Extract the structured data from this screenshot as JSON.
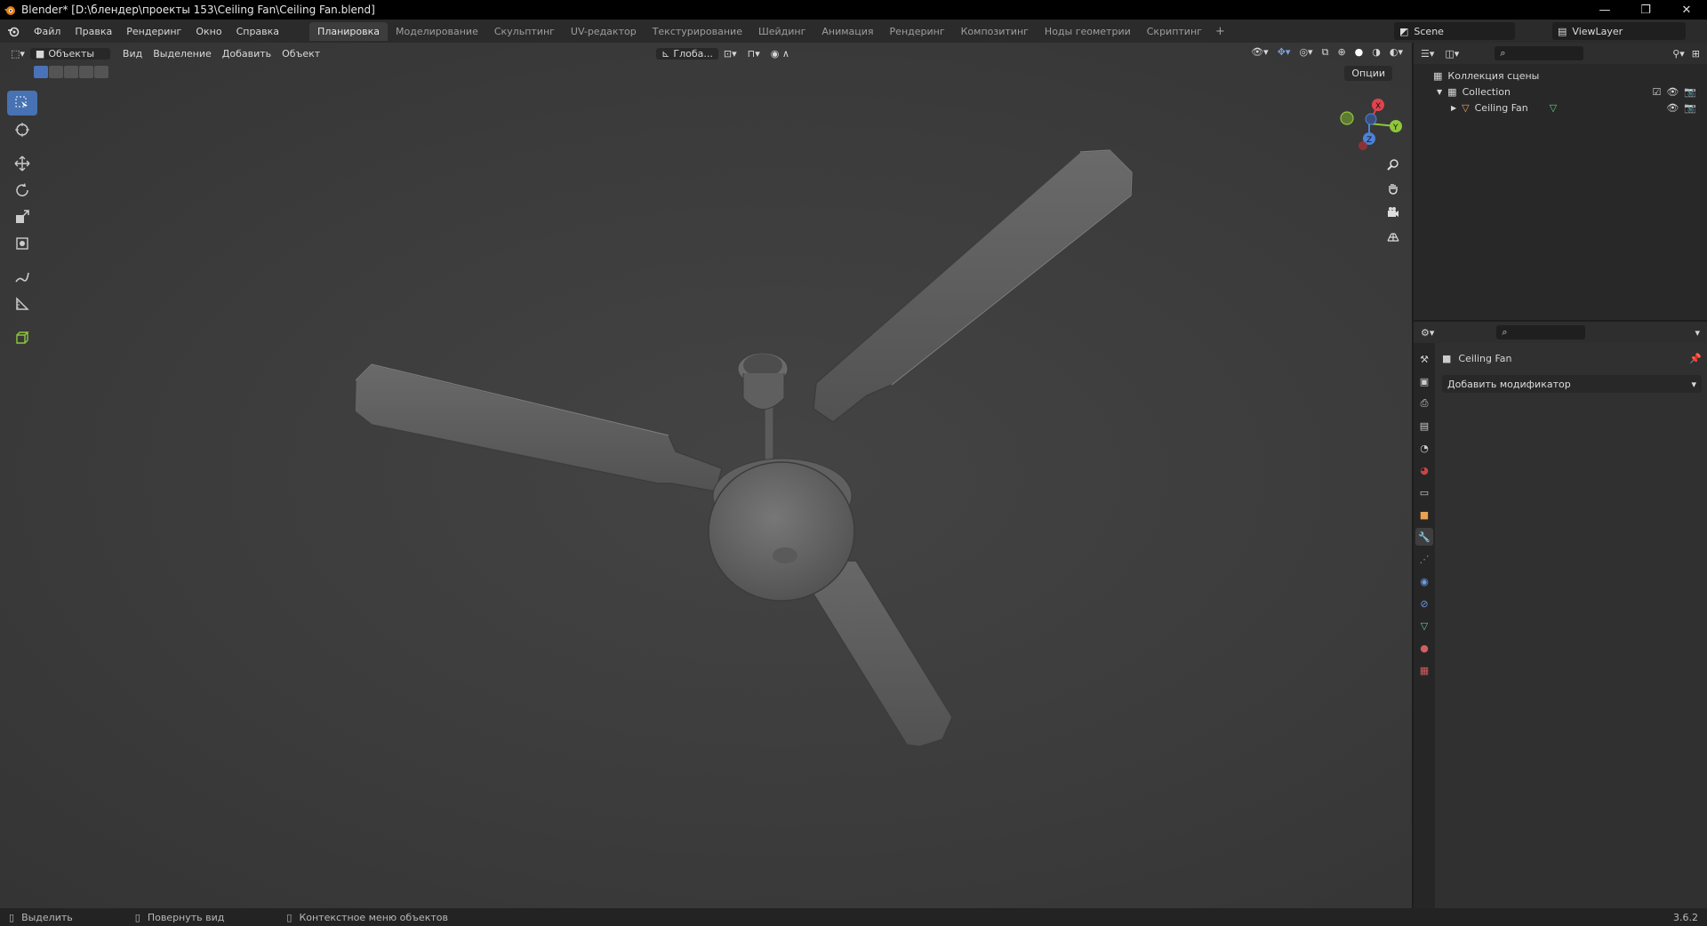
{
  "window": {
    "title": "Blender* [D:\\блендер\\проекты 153\\Ceiling Fan\\Ceiling Fan.blend]",
    "controls": [
      "—",
      "❐",
      "✕"
    ]
  },
  "menu": [
    "Файл",
    "Правка",
    "Рендеринг",
    "Окно",
    "Справка"
  ],
  "workspace_tabs": [
    {
      "label": "Планировка",
      "active": true
    },
    {
      "label": "Моделирование"
    },
    {
      "label": "Скульптинг"
    },
    {
      "label": "UV-редактор"
    },
    {
      "label": "Текстурирование"
    },
    {
      "label": "Шейдинг"
    },
    {
      "label": "Анимация"
    },
    {
      "label": "Рендеринг"
    },
    {
      "label": "Композитинг"
    },
    {
      "label": "Ноды геометрии"
    },
    {
      "label": "Скриптинг"
    }
  ],
  "workspace_add": "+",
  "scene": {
    "label": "Scene",
    "view_layer": "ViewLayer"
  },
  "viewport": {
    "mode": "Объекты",
    "menus": [
      "Вид",
      "Выделение",
      "Добавить",
      "Объект"
    ],
    "transform_orientation": "Глоба...",
    "options_label": "Опции",
    "tools": [
      "select-box-icon",
      "cursor-icon",
      "move-icon",
      "rotate-icon",
      "scale-icon",
      "transform-icon",
      "annotate-icon",
      "measure-icon",
      "add-cube-icon"
    ],
    "axis_labels": {
      "x": "X",
      "y": "Y",
      "z": "Z"
    }
  },
  "outliner": {
    "scene_collection": "Коллекция сцены",
    "collection": "Collection",
    "object": "Ceiling Fan"
  },
  "properties": {
    "object_name": "Ceiling Fan",
    "add_modifier": "Добавить модификатор"
  },
  "status": {
    "select": "Выделить",
    "rotate": "Повернуть вид",
    "context": "Контекстное меню объектов",
    "version": "3.6.2"
  },
  "colors": {
    "accent": "#4772b3",
    "x_axis": "#e0434e",
    "y_axis": "#8fc63c",
    "z_axis": "#4d82d6"
  }
}
